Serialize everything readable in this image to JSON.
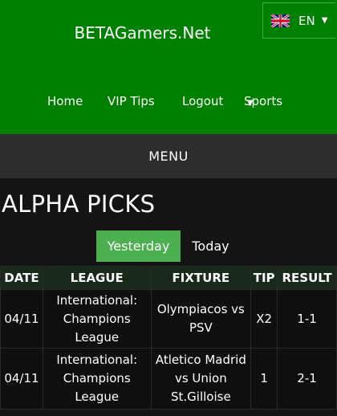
{
  "header": {
    "brand": "BETAGamers.Net",
    "language": "EN",
    "flag_icon": "uk-flag-icon"
  },
  "nav": {
    "items": [
      "Home",
      "VIP Tips",
      "Logout",
      "Sports"
    ]
  },
  "menu_label": "MENU",
  "page_title": "ALPHA PICKS",
  "tabs": {
    "yesterday": "Yesterday",
    "today": "Today",
    "active": "Yesterday"
  },
  "table": {
    "headers": [
      "DATE",
      "LEAGUE",
      "FIXTURE",
      "TIP",
      "RESULT"
    ],
    "rows": [
      {
        "date": "04/11",
        "league": "International: Champions League",
        "fixture": "Olympiacos vs PSV",
        "tip": "X2",
        "result": "1-1"
      },
      {
        "date": "04/11",
        "league": "International: Champions League",
        "fixture": "Atletico Madrid vs Union St.Gilloise",
        "tip": "1",
        "result": "2-1"
      }
    ]
  },
  "colors": {
    "header_green": "#008000",
    "active_tab": "#4caf50",
    "menu_bar": "#2d2d2d",
    "background": "#141414"
  }
}
